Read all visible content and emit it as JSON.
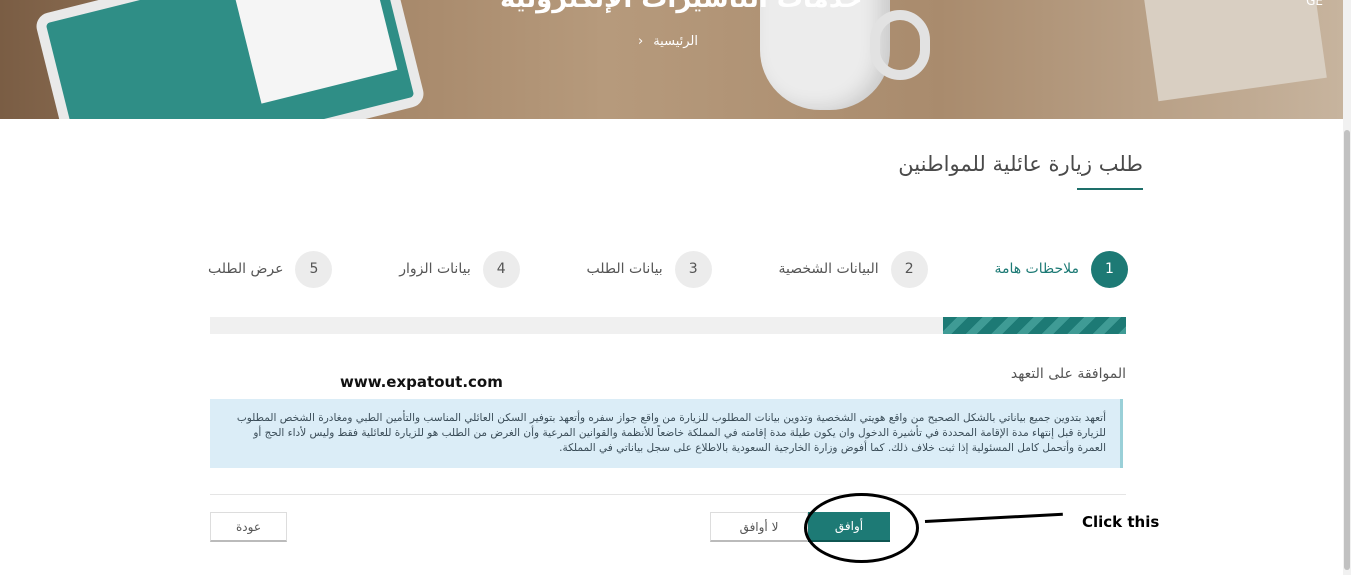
{
  "header": {
    "title_fragment": "خدمات التأشيرات الإلكترونية",
    "breadcrumb": {
      "home_label": "الرئيسية",
      "separator": "‹"
    },
    "corner_text": "GE"
  },
  "page": {
    "title": "طلب زيارة عائلية للمواطنين"
  },
  "steps": [
    {
      "number": "1",
      "label": "ملاحظات هامة",
      "active": true
    },
    {
      "number": "2",
      "label": "البيانات الشخصية",
      "active": false
    },
    {
      "number": "3",
      "label": "بيانات الطلب",
      "active": false
    },
    {
      "number": "4",
      "label": "بيانات الزوار",
      "active": false
    },
    {
      "number": "5",
      "label": "عرض الطلب",
      "active": false
    }
  ],
  "progress": {
    "fraction": 0.2
  },
  "pledge": {
    "heading": "الموافقة على التعهد",
    "text": "أتعهد بتدوين جميع بياناتي بالشكل الصحيح من واقع هويتي الشخصية وتدوين بيانات المطلوب للزيارة من واقع جواز سفره وأتعهد بتوفير السكن العائلي المناسب والتأمين الطبي ومغادرة الشخص المطلوب للزيارة قبل إنتهاء مدة الإقامة المحددة في تأشيرة الدخول وان يكون طيلة مدة إقامته في المملكة خاضعاً للأنظمة والقوانين المرعية وأن الغرض من الطلب هو للزيارة للعائلية فقط وليس لأداء الحج أو العمرة وأتحمل كامل المسئولية إذا ثبت خلاف ذلك. كما أفوض وزارة الخارجية السعودية بالاطلاع على سجل بياناتي في المملكة."
  },
  "buttons": {
    "agree": "أوافق",
    "disagree": "لا أوافق",
    "back": "عودة"
  },
  "annotation": {
    "watermark": "www.expatout.com",
    "click_text": "Click this"
  },
  "colors": {
    "accent": "#1d7a75",
    "info_box": "#dbedf7"
  }
}
